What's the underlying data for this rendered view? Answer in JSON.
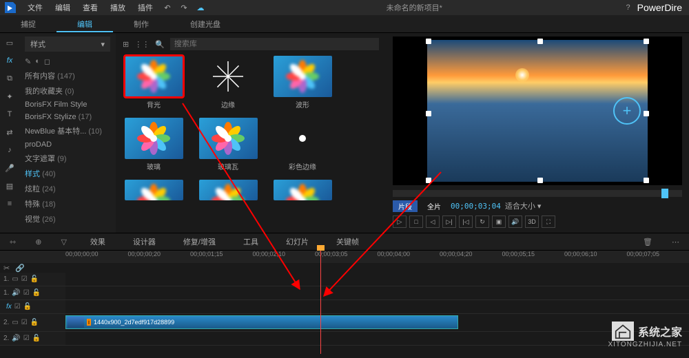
{
  "menu": {
    "items": [
      "文件",
      "编辑",
      "查看",
      "播放",
      "插件"
    ],
    "title": "未命名的新项目*",
    "help": "?",
    "brand": "PowerDire"
  },
  "top_tabs": {
    "items": [
      "捕捉",
      "编辑",
      "制作",
      "创建光盘"
    ],
    "active_index": 1
  },
  "category_panel": {
    "dropdown_label": "样式",
    "items": [
      {
        "label": "所有内容",
        "count": "(147)"
      },
      {
        "label": "我的收藏夹",
        "count": "(0)"
      },
      {
        "label": "BorisFX Film Style",
        "count": ""
      },
      {
        "label": "BorisFX Stylize",
        "count": "(17)"
      },
      {
        "label": "NewBlue 基本特...",
        "count": "(10)"
      },
      {
        "label": "proDAD",
        "count": ""
      },
      {
        "label": "文字遮罩",
        "count": "(9)"
      },
      {
        "label": "样式",
        "count": "(40)",
        "selected": true
      },
      {
        "label": "炫粒",
        "count": "(24)"
      },
      {
        "label": "特殊",
        "count": "(18)"
      },
      {
        "label": "视觉",
        "count": "(26)"
      }
    ]
  },
  "library": {
    "search_placeholder": "搜索库",
    "thumbs": [
      {
        "label": "背光",
        "highlighted": true,
        "bg": "flower-blur"
      },
      {
        "label": "边缘",
        "bg": "edge"
      },
      {
        "label": "波形",
        "bg": "flower-blur2"
      },
      {
        "label": "玻璃",
        "bg": "flower-glass"
      },
      {
        "label": "玻璃瓦",
        "bg": "flower-tile"
      },
      {
        "label": "彩色边缘",
        "bg": "flower-color"
      }
    ]
  },
  "preview": {
    "tag_clip": "片段",
    "tag_all": "全片",
    "timecode": "00;00;03;04",
    "fit_label": "适合大小",
    "playback_3d": "3D"
  },
  "action_toolbar": {
    "buttons": [
      "效果",
      "设计器",
      "修复/增强",
      "工具",
      "幻灯片",
      "关键帧"
    ]
  },
  "timeline": {
    "ruler": [
      "00;00;00;00",
      "00;00;00;20",
      "00;00;01;15",
      "00;00;02;10",
      "00;00;03;05",
      "00;00;04;00",
      "00;00;04;20",
      "00;00;05;15",
      "00;00;06;10",
      "00;00;07;05"
    ],
    "tracks": [
      {
        "num": "1.",
        "icon": "video"
      },
      {
        "num": "1.",
        "icon": "audio"
      },
      {
        "num": "",
        "icon": "fx"
      },
      {
        "num": "2.",
        "icon": "video",
        "clip": true
      },
      {
        "num": "2.",
        "icon": "audio"
      }
    ],
    "clip_label": "1440x900_2d7edf917d28899"
  },
  "watermark": {
    "text": "系统之家",
    "url": "XITONGZHIJIA.NET"
  }
}
